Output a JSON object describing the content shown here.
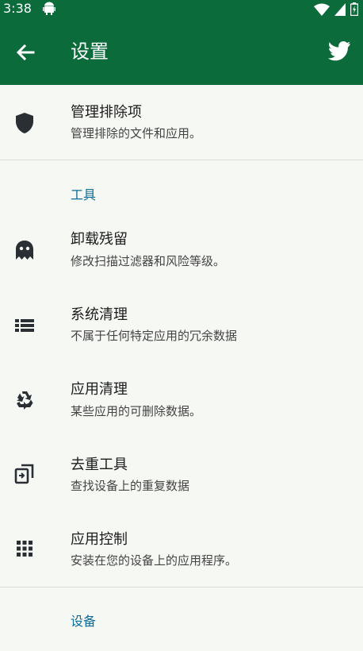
{
  "status_bar": {
    "time": "3:38"
  },
  "app_bar": {
    "title": "设置"
  },
  "exclusions": {
    "title": "管理排除项",
    "subtitle": "管理排除的文件和应用。"
  },
  "tools_section": {
    "label": "工具"
  },
  "tools": [
    {
      "title": "卸载残留",
      "subtitle": "修改扫描过滤器和风险等级。",
      "icon": "ghost-icon"
    },
    {
      "title": "系统清理",
      "subtitle": "不属于任何特定应用的冗余数据",
      "icon": "list-icon"
    },
    {
      "title": "应用清理",
      "subtitle": "某些应用的可删除数据。",
      "icon": "recycle-icon"
    },
    {
      "title": "去重工具",
      "subtitle": "查找设备上的重复数据",
      "icon": "duplicate-icon"
    },
    {
      "title": "应用控制",
      "subtitle": "安装在您的设备上的应用程序。",
      "icon": "apps-grid-icon"
    }
  ],
  "device_section": {
    "label": "设备"
  },
  "colors": {
    "primary": "#0b6b3a",
    "accent": "#0b6b9a",
    "background": "#f6f8f4"
  }
}
